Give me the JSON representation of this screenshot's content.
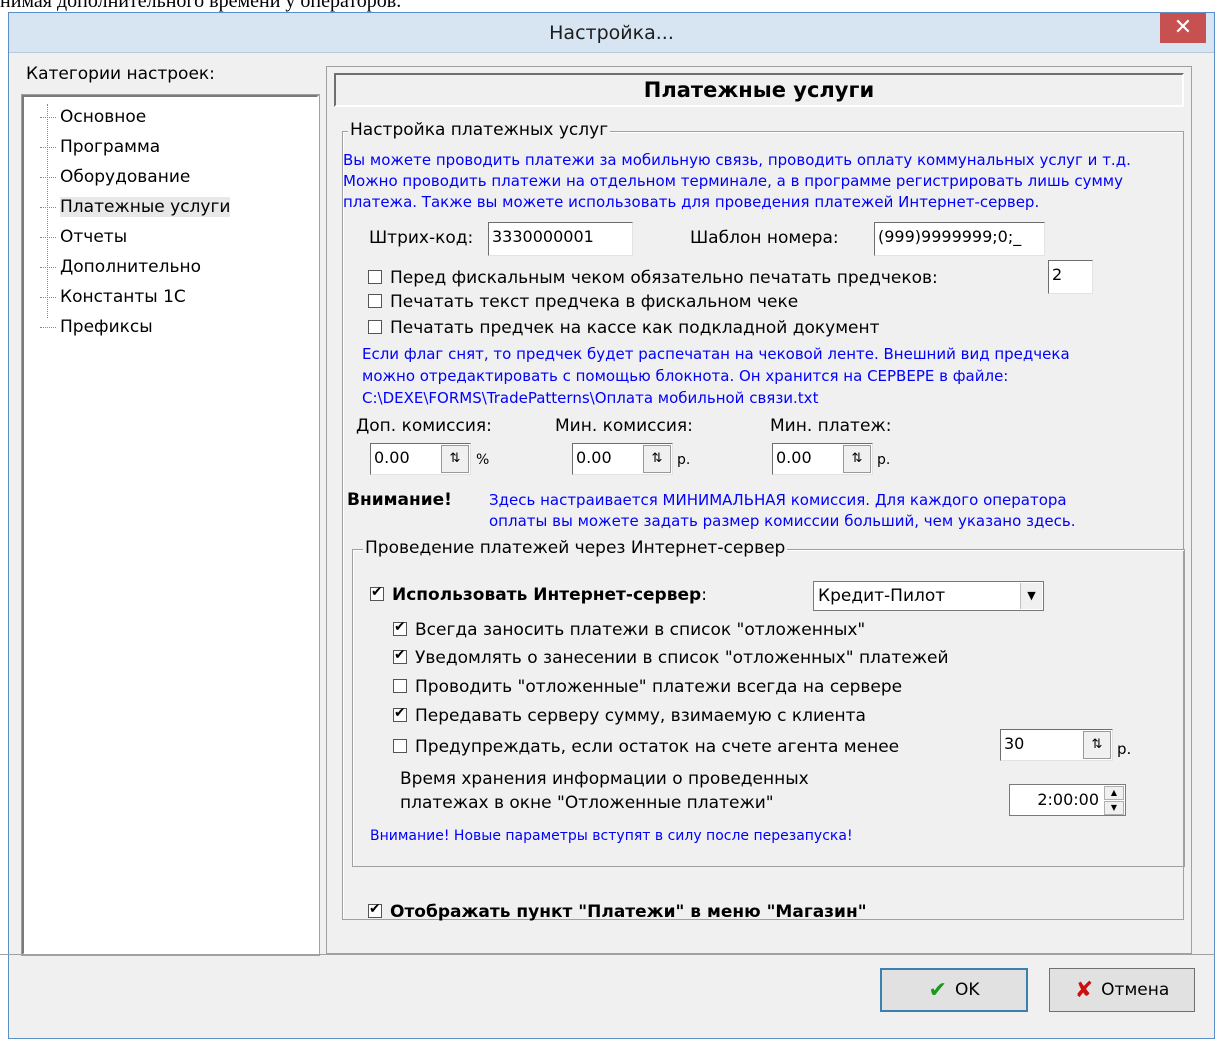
{
  "page_text": {
    "top_line": "нимая дополнительного времени у операторов."
  },
  "window": {
    "title": "Настройка...",
    "close_symbol": "✕"
  },
  "categories": {
    "label": "Категории настроек:",
    "items": [
      "Основное",
      "Программа",
      "Оборудование",
      "Платежные услуги",
      "Отчеты",
      "Дополнительно",
      "Константы 1С",
      "Префиксы"
    ],
    "selected_index": 3
  },
  "panel": {
    "header": "Платежные услуги"
  },
  "settings_group": {
    "title": "Настройка платежных услуг",
    "info_lines": [
      "Вы можете проводить платежи за мобильную связь, проводить оплату коммунальных услуг и т.д.",
      "Можно проводить платежи на отдельном терминале, а в программе регистрировать лишь сумму",
      "платежа. Также вы можете использовать для проведения платежей Интернет-сервер."
    ],
    "barcode_label": "Штрих-код:",
    "barcode_value": "3330000001",
    "template_label": "Шаблон номера:",
    "template_value": "(999)9999999;0;_",
    "cb_pre_receipt": "Перед фискальным чеком обязательно печатать предчеков:",
    "pre_receipt_count": "2",
    "cb_print_text": "Печатать текст предчека в фискальном чеке",
    "cb_print_doc": "Печатать предчек на кассе как подкладной документ",
    "note_lines": [
      "Если флаг снят, то предчек будет распечатан на чековой ленте. Внешний вид предчека",
      "можно отредактировать с помощью блокнота. Он хранится на СЕРВЕРЕ в файле:",
      "C:\\DEXE\\FORMS\\TradePatterns\\Оплата мобильной связи.txt"
    ],
    "extra_fee_label": "Доп. комиссия:",
    "extra_fee_value": "0.00",
    "extra_fee_unit": "%",
    "min_fee_label": "Мин. комиссия:",
    "min_fee_value": "0.00",
    "min_fee_unit": "р.",
    "min_payment_label": "Мин. платеж:",
    "min_payment_value": "0.00",
    "min_payment_unit": "р.",
    "attention_label": "Внимание!",
    "attention_lines": [
      "Здесь настраивается МИНИМАЛЬНАЯ комиссия. Для каждого оператора",
      "оплаты вы можете задать размер комиссии больший, чем указано здесь."
    ]
  },
  "internet_group": {
    "title": "Проведение платежей через Интернет-сервер",
    "use_server_label": "Использовать Интернет-сервер",
    "use_server_colon": ":",
    "server_value": "Кредит-Пилот",
    "cb_always_deferred": "Всегда заносить платежи в список \"отложенных\"",
    "cb_notify_deferred": "Уведомлять о занесении в список \"отложенных\" платежей",
    "cb_deferred_on_server": "Проводить \"отложенные\" платежи всегда на сервере",
    "cb_send_amount": "Передавать серверу сумму, взимаемую с клиента",
    "cb_warn_balance": "Предупреждать, если остаток на счете агента менее",
    "warn_balance_value": "30",
    "warn_balance_unit": "р.",
    "storage_time_lines": [
      "Время хранения информации о проведенных",
      "платежах в окне \"Отложенные платежи\""
    ],
    "storage_time_value": "2:00:00",
    "restart_note": "Внимание! Новые параметры вступят в силу после перезапуска!"
  },
  "show_menu_label": "Отображать пункт \"Платежи\" в меню \"Магазин\"",
  "buttons": {
    "ok": "OK",
    "cancel": "Отмена"
  }
}
